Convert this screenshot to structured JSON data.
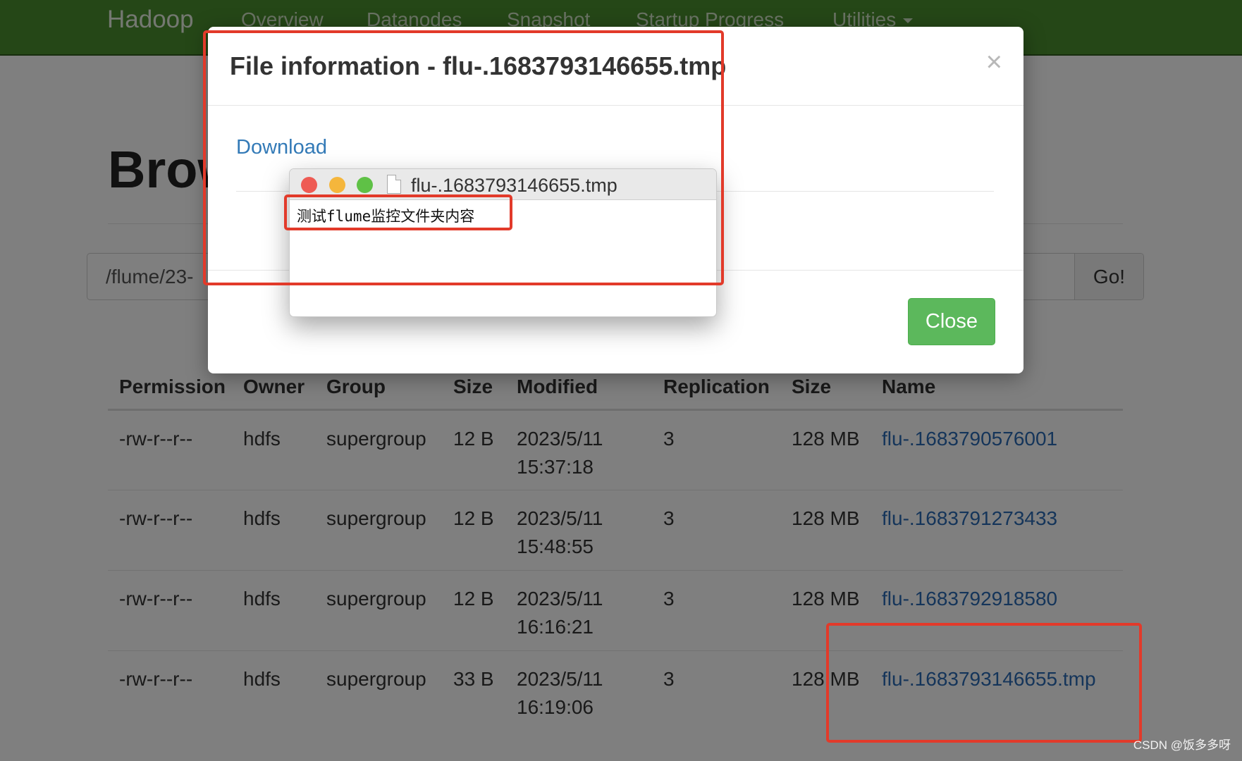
{
  "navbar": {
    "brand": "Hadoop",
    "items": [
      "Overview",
      "Datanodes",
      "Snapshot",
      "Startup Progress",
      "Utilities"
    ]
  },
  "page": {
    "title": "Brow",
    "path_value": "/flume/23-",
    "go_label": "Go!"
  },
  "table": {
    "headers": [
      "Permission",
      "Owner",
      "Group",
      "Size",
      "Modified",
      "Replication",
      "Size",
      "Name"
    ],
    "rows": [
      {
        "permission": "-rw-r--r--",
        "owner": "hdfs",
        "group": "supergroup",
        "size": "12 B",
        "modified": "2023/5/11 15:37:18",
        "replication": "3",
        "block_size": "128 MB",
        "name": "flu-.1683790576001"
      },
      {
        "permission": "-rw-r--r--",
        "owner": "hdfs",
        "group": "supergroup",
        "size": "12 B",
        "modified": "2023/5/11 15:48:55",
        "replication": "3",
        "block_size": "128 MB",
        "name": "flu-.1683791273433"
      },
      {
        "permission": "-rw-r--r--",
        "owner": "hdfs",
        "group": "supergroup",
        "size": "12 B",
        "modified": "2023/5/11 16:16:21",
        "replication": "3",
        "block_size": "128 MB",
        "name": "flu-.1683792918580"
      },
      {
        "permission": "-rw-r--r--",
        "owner": "hdfs",
        "group": "supergroup",
        "size": "33 B",
        "modified": "2023/5/11 16:19:06",
        "replication": "3",
        "block_size": "128 MB",
        "name": "flu-.1683793146655.tmp"
      }
    ]
  },
  "modal": {
    "title": "File information - flu-.1683793146655.tmp",
    "close_symbol": "×",
    "download_label": "Download",
    "close_button_label": "Close"
  },
  "preview_window": {
    "title": "flu-.1683793146655.tmp",
    "content": "测试flume监控文件夹内容"
  },
  "watermark": "CSDN @饭多多呀",
  "colors": {
    "navbar": "#4a8f2e",
    "link": "#337ab7",
    "close_button": "#5cb85c",
    "annotation": "#e23a2a"
  }
}
